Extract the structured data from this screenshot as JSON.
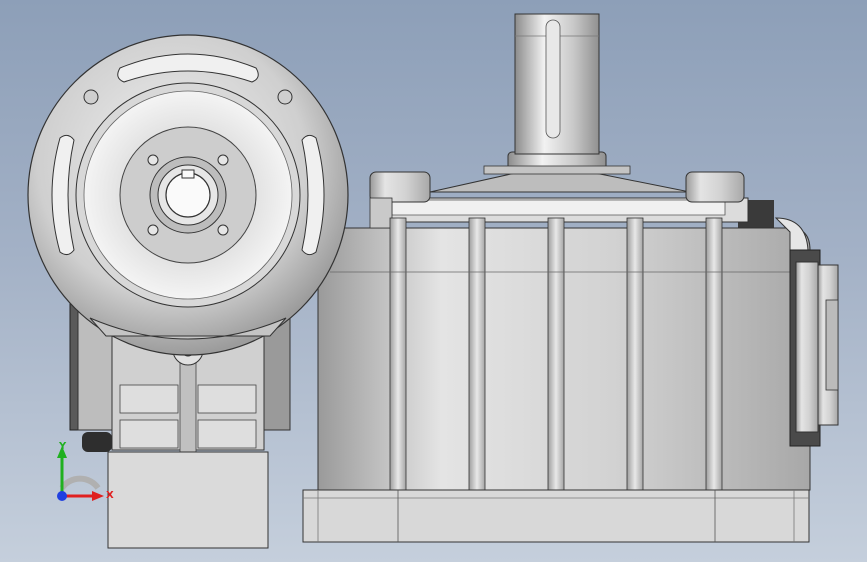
{
  "viewport": {
    "background_top": "#8d9fb8",
    "background_bottom": "#c5cfdc",
    "model_name": "worm-gear-reducer"
  },
  "triad": {
    "x_label": "X",
    "y_label": "Y",
    "x_color": "#e02020",
    "y_color": "#20b020",
    "z_color": "#2040e0"
  }
}
